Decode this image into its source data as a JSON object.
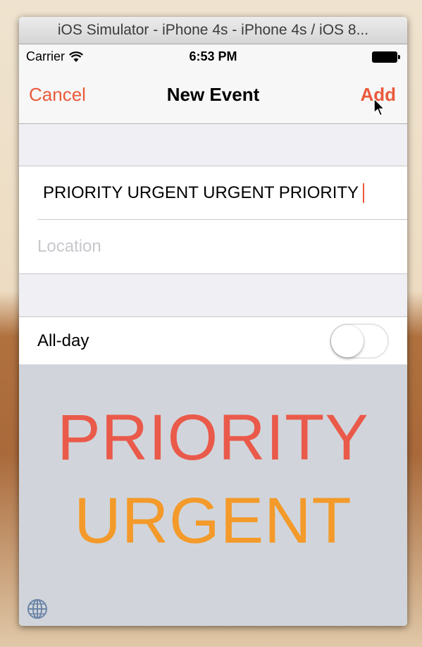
{
  "window": {
    "title": "iOS Simulator - iPhone 4s - iPhone 4s / iOS 8..."
  },
  "status_bar": {
    "carrier": "Carrier",
    "time": "6:53 PM"
  },
  "nav": {
    "cancel": "Cancel",
    "title": "New Event",
    "add": "Add"
  },
  "form": {
    "title_value": "PRIORITY URGENT URGENT PRIORITY",
    "location_placeholder": "Location",
    "allday_label": "All-day",
    "allday_on": false
  },
  "keyboard": {
    "suggestion_1": "PRIORITY",
    "suggestion_2": "URGENT"
  },
  "colors": {
    "accent": "#ea5a3c",
    "suggestion_1": "#ea5a4a",
    "suggestion_2": "#f39a2a"
  }
}
